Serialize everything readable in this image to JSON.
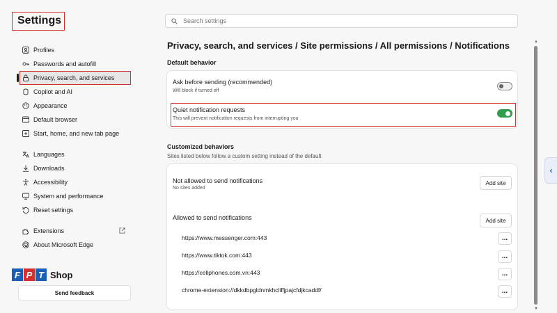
{
  "sidebar": {
    "title": "Settings",
    "items": [
      {
        "label": "Profiles",
        "icon": "profile-icon"
      },
      {
        "label": "Passwords and autofill",
        "icon": "key-icon"
      },
      {
        "label": "Privacy, search, and services",
        "icon": "lock-icon",
        "active": true
      },
      {
        "label": "Copilot and AI",
        "icon": "copilot-icon"
      },
      {
        "label": "Appearance",
        "icon": "appearance-icon"
      },
      {
        "label": "Default browser",
        "icon": "browser-icon"
      },
      {
        "label": "Start, home, and new tab page",
        "icon": "home-icon"
      },
      {
        "label": "Languages",
        "icon": "languages-icon"
      },
      {
        "label": "Downloads",
        "icon": "download-icon"
      },
      {
        "label": "Accessibility",
        "icon": "accessibility-icon"
      },
      {
        "label": "System and performance",
        "icon": "system-icon"
      },
      {
        "label": "Reset settings",
        "icon": "reset-icon"
      },
      {
        "label": "Extensions",
        "icon": "extensions-icon"
      },
      {
        "label": "About Microsoft Edge",
        "icon": "edge-icon"
      }
    ],
    "feedback_label": "Send feedback"
  },
  "logo": {
    "letters": [
      "F",
      "P",
      "T"
    ],
    "text": "Shop",
    "colors": [
      "#1a5fb4",
      "#d32f2f",
      "#1a5fb4"
    ]
  },
  "search": {
    "placeholder": "Search settings"
  },
  "breadcrumb": "Privacy, search, and services / Site permissions / All permissions / Notifications",
  "default_behavior": {
    "heading": "Default behavior",
    "items": [
      {
        "title": "Ask before sending (recommended)",
        "subtitle": "Will block if turned off",
        "enabled": false
      },
      {
        "title": "Quiet notification requests",
        "subtitle": "This will prevent notification requests from interrupting you",
        "enabled": true
      }
    ]
  },
  "customized": {
    "heading": "Customized behaviors",
    "subtitle": "Sites listed below follow a custom setting instead of the default",
    "blocked": {
      "title": "Not allowed to send notifications",
      "empty_text": "No sites added",
      "add_label": "Add site"
    },
    "allowed": {
      "title": "Allowed to send notifications",
      "add_label": "Add site",
      "sites": [
        "https://www.messenger.com:443",
        "https://www.tiktok.com:443",
        "https://cellphones.com.vn:443",
        "chrome-extension://dkkdbpgldnmkhcliffjpajcfdjkcaddf/"
      ],
      "more_label": "..."
    }
  },
  "colors": {
    "accent": "#2e9e4a",
    "highlight": "#d32f2f",
    "link": "#1c5fc9"
  }
}
